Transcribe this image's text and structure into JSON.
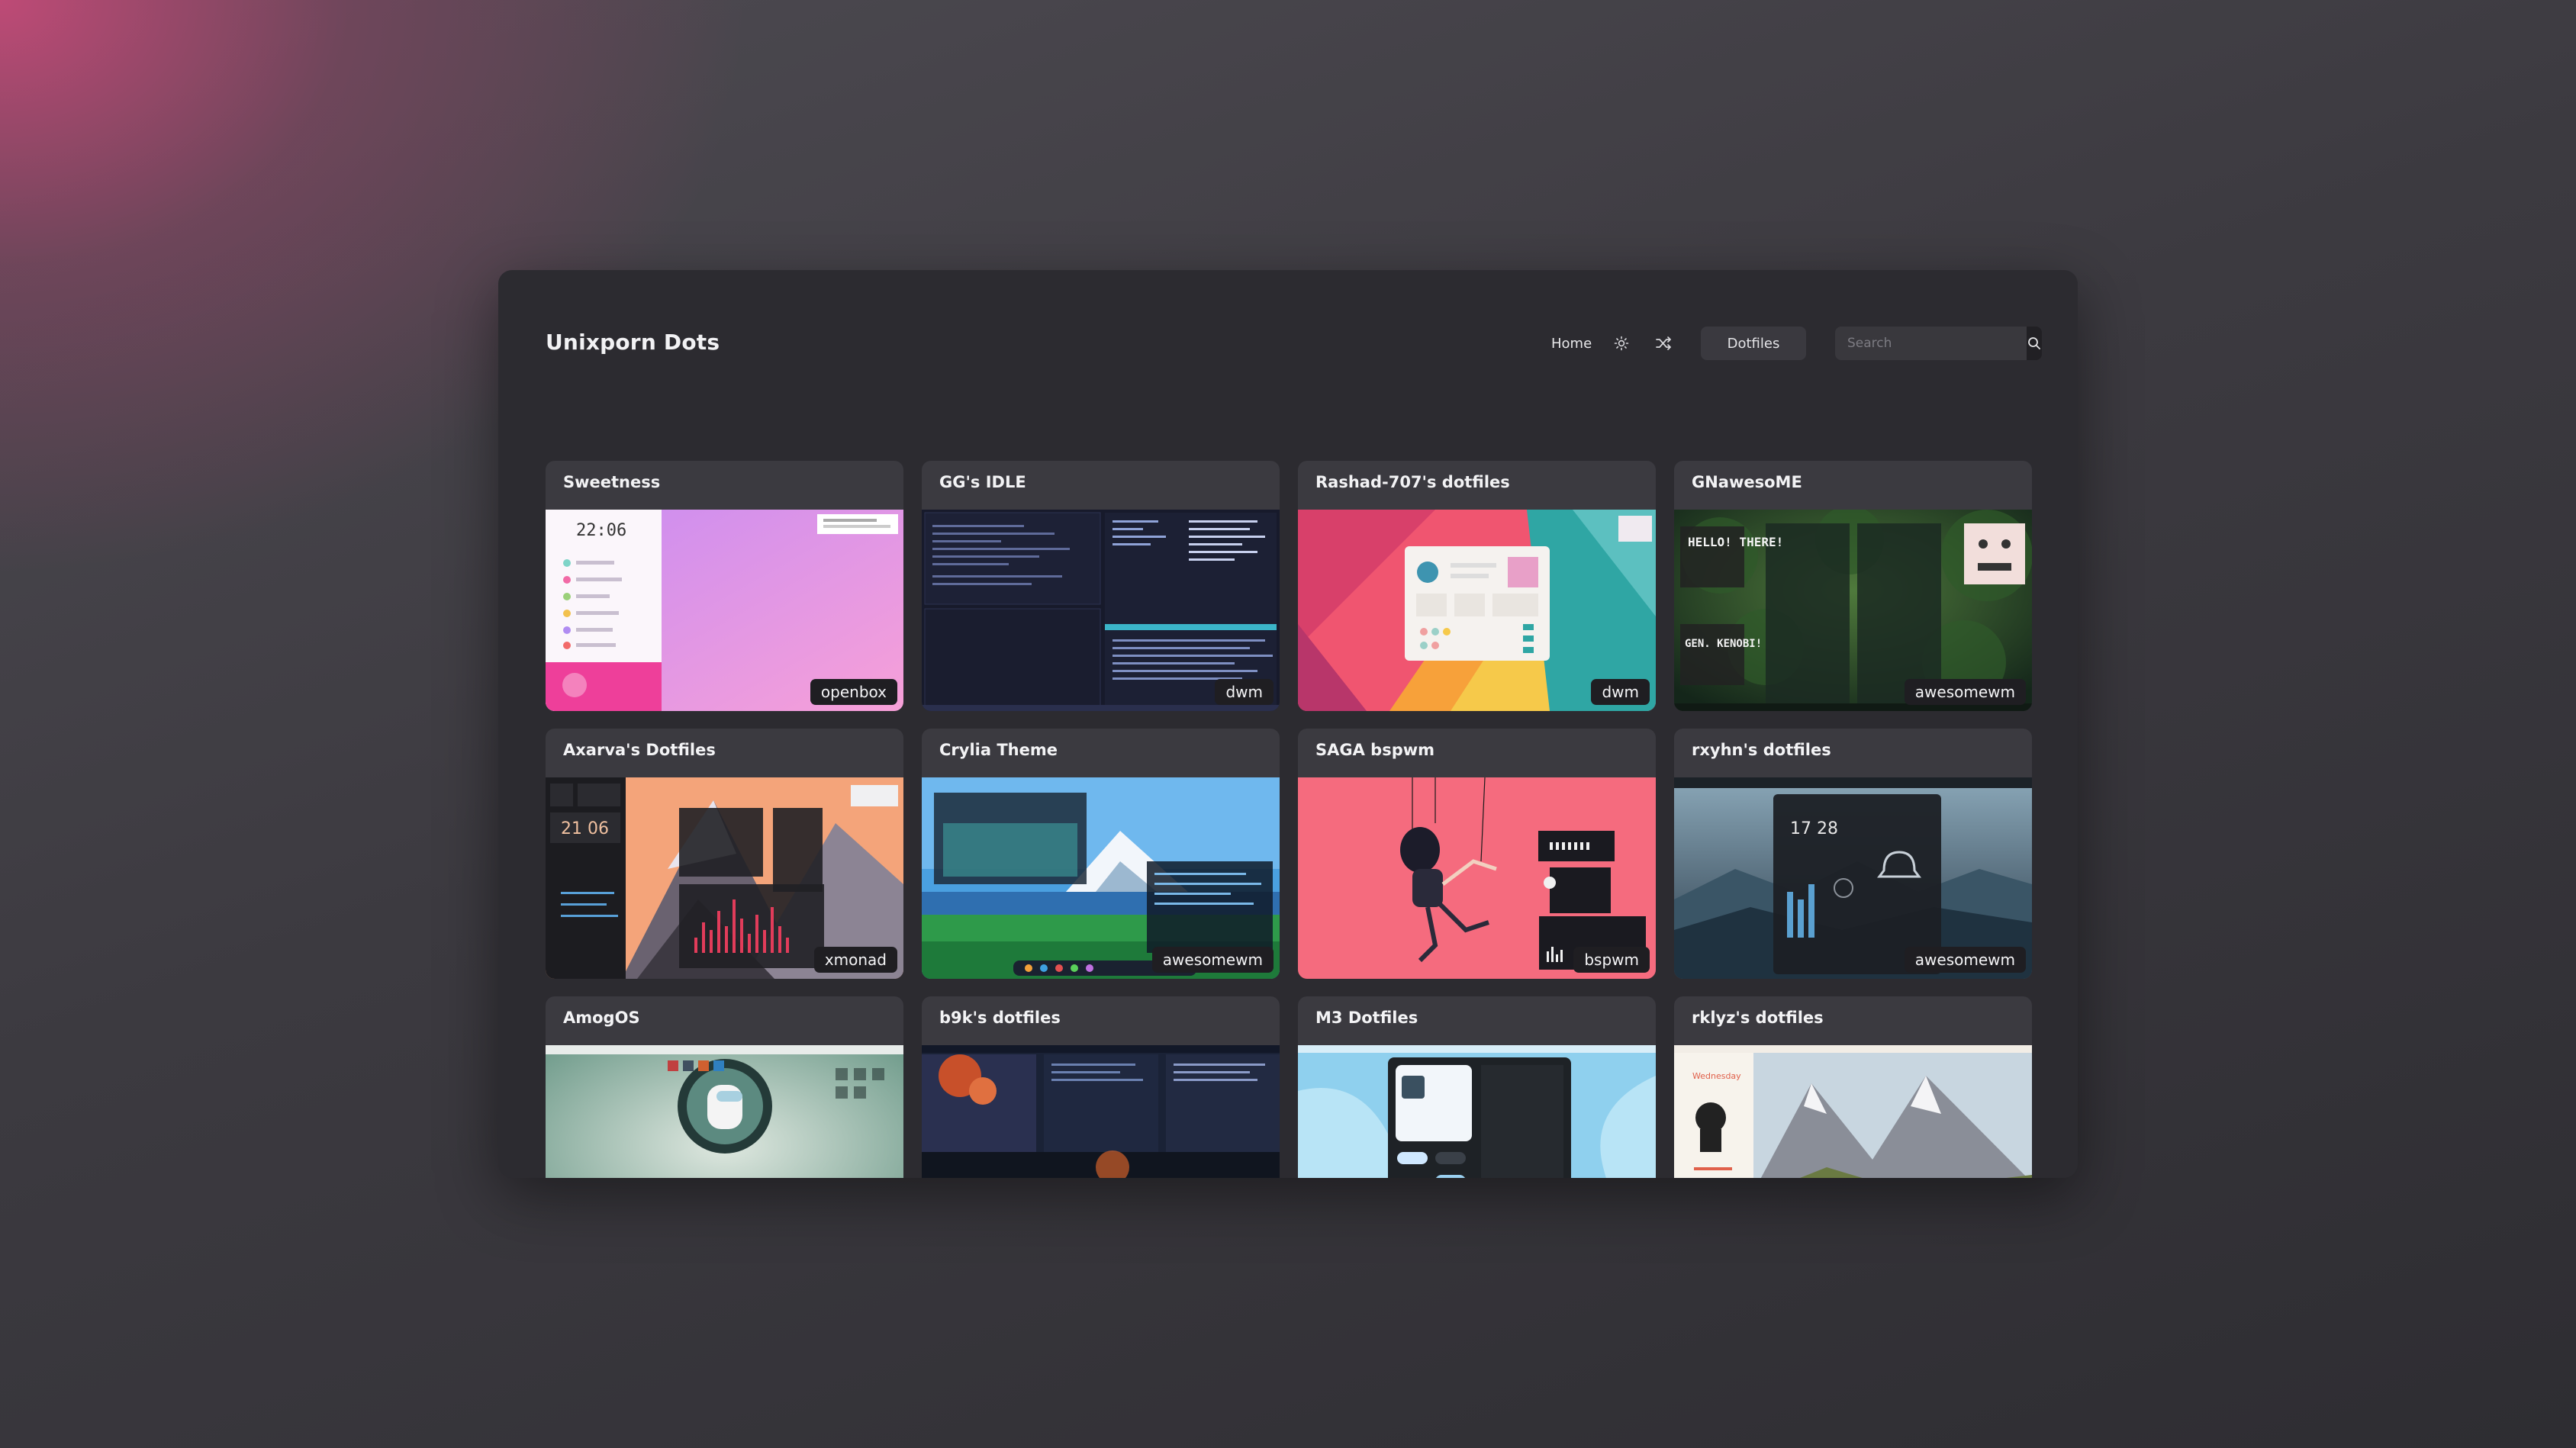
{
  "app": {
    "title": "Unixporn Dots"
  },
  "nav": {
    "home": "Home",
    "theme_icon": "sun-icon",
    "shuffle_icon": "shuffle-icon",
    "dotfiles": "Dotfiles",
    "search_placeholder": "Search",
    "search_icon": "search-icon"
  },
  "cards": [
    {
      "title": "Sweetness",
      "wm": "openbox",
      "clock": "22:06"
    },
    {
      "title": "GG's IDLE",
      "wm": "dwm"
    },
    {
      "title": "Rashad-707's dotfiles",
      "wm": "dwm"
    },
    {
      "title": "GNawesoME",
      "wm": "awesomewm",
      "overlay_text": "HELLO! THERE!",
      "overlay_text2": "GEN. KENOBI!"
    },
    {
      "title": "Axarva's Dotfiles",
      "wm": "xmonad",
      "clock": "21 06"
    },
    {
      "title": "Crylia Theme",
      "wm": "awesomewm"
    },
    {
      "title": "SAGA bspwm",
      "wm": "bspwm"
    },
    {
      "title": "rxyhn's dotfiles",
      "wm": "awesomewm",
      "clock": "17 28"
    },
    {
      "title": "AmogOS",
      "wm": ""
    },
    {
      "title": "b9k's dotfiles",
      "wm": ""
    },
    {
      "title": "M3 Dotfiles",
      "wm": ""
    },
    {
      "title": "rklyz's dotfiles",
      "wm": "",
      "day": "Wednesday"
    }
  ]
}
